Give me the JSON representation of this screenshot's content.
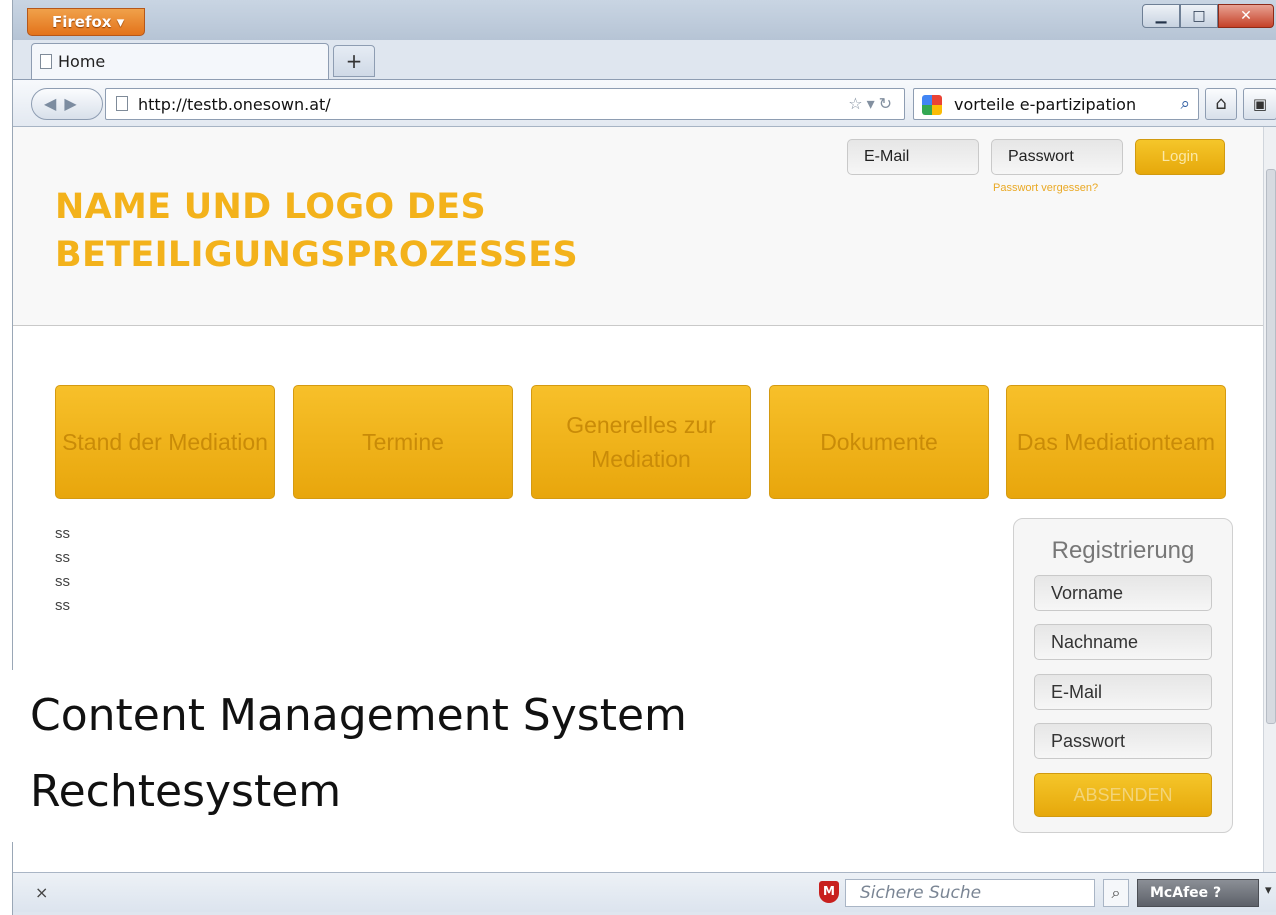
{
  "browser": {
    "app_button": "Firefox",
    "tab_title": "Home",
    "new_tab": "+",
    "url": "http://testb.onesown.at/",
    "search_text": "vorteile e-partizipation",
    "status_close": "×",
    "secure_search_placeholder": "Sichere Suche",
    "mcafee_label": "McAfee"
  },
  "header": {
    "logo_text": "NAME UND LOGO DES BETEILIGUNGSPROZESSES",
    "email_placeholder": "E-Mail",
    "password_placeholder": "Passwort",
    "login_label": "Login",
    "forgot_password": "Passwort vergessen?"
  },
  "nav": {
    "items": [
      {
        "label": "Stand der Mediation"
      },
      {
        "label": "Termine"
      },
      {
        "label": "Generelles zur Mediation"
      },
      {
        "label": "Dokumente"
      },
      {
        "label": "Das Mediationteam"
      }
    ]
  },
  "content": {
    "lines": [
      "ss",
      "ss",
      "ss",
      "ss"
    ]
  },
  "registration": {
    "title": "Registrierung",
    "first_name": "Vorname",
    "last_name": "Nachname",
    "email": "E-Mail",
    "password": "Passwort",
    "submit_label": "ABSENDEN"
  },
  "overlay": {
    "line1": "Content Management System",
    "line2": "Rechtesystem"
  },
  "colors": {
    "accent": "#f3b21b",
    "tile": "#f0b317"
  }
}
